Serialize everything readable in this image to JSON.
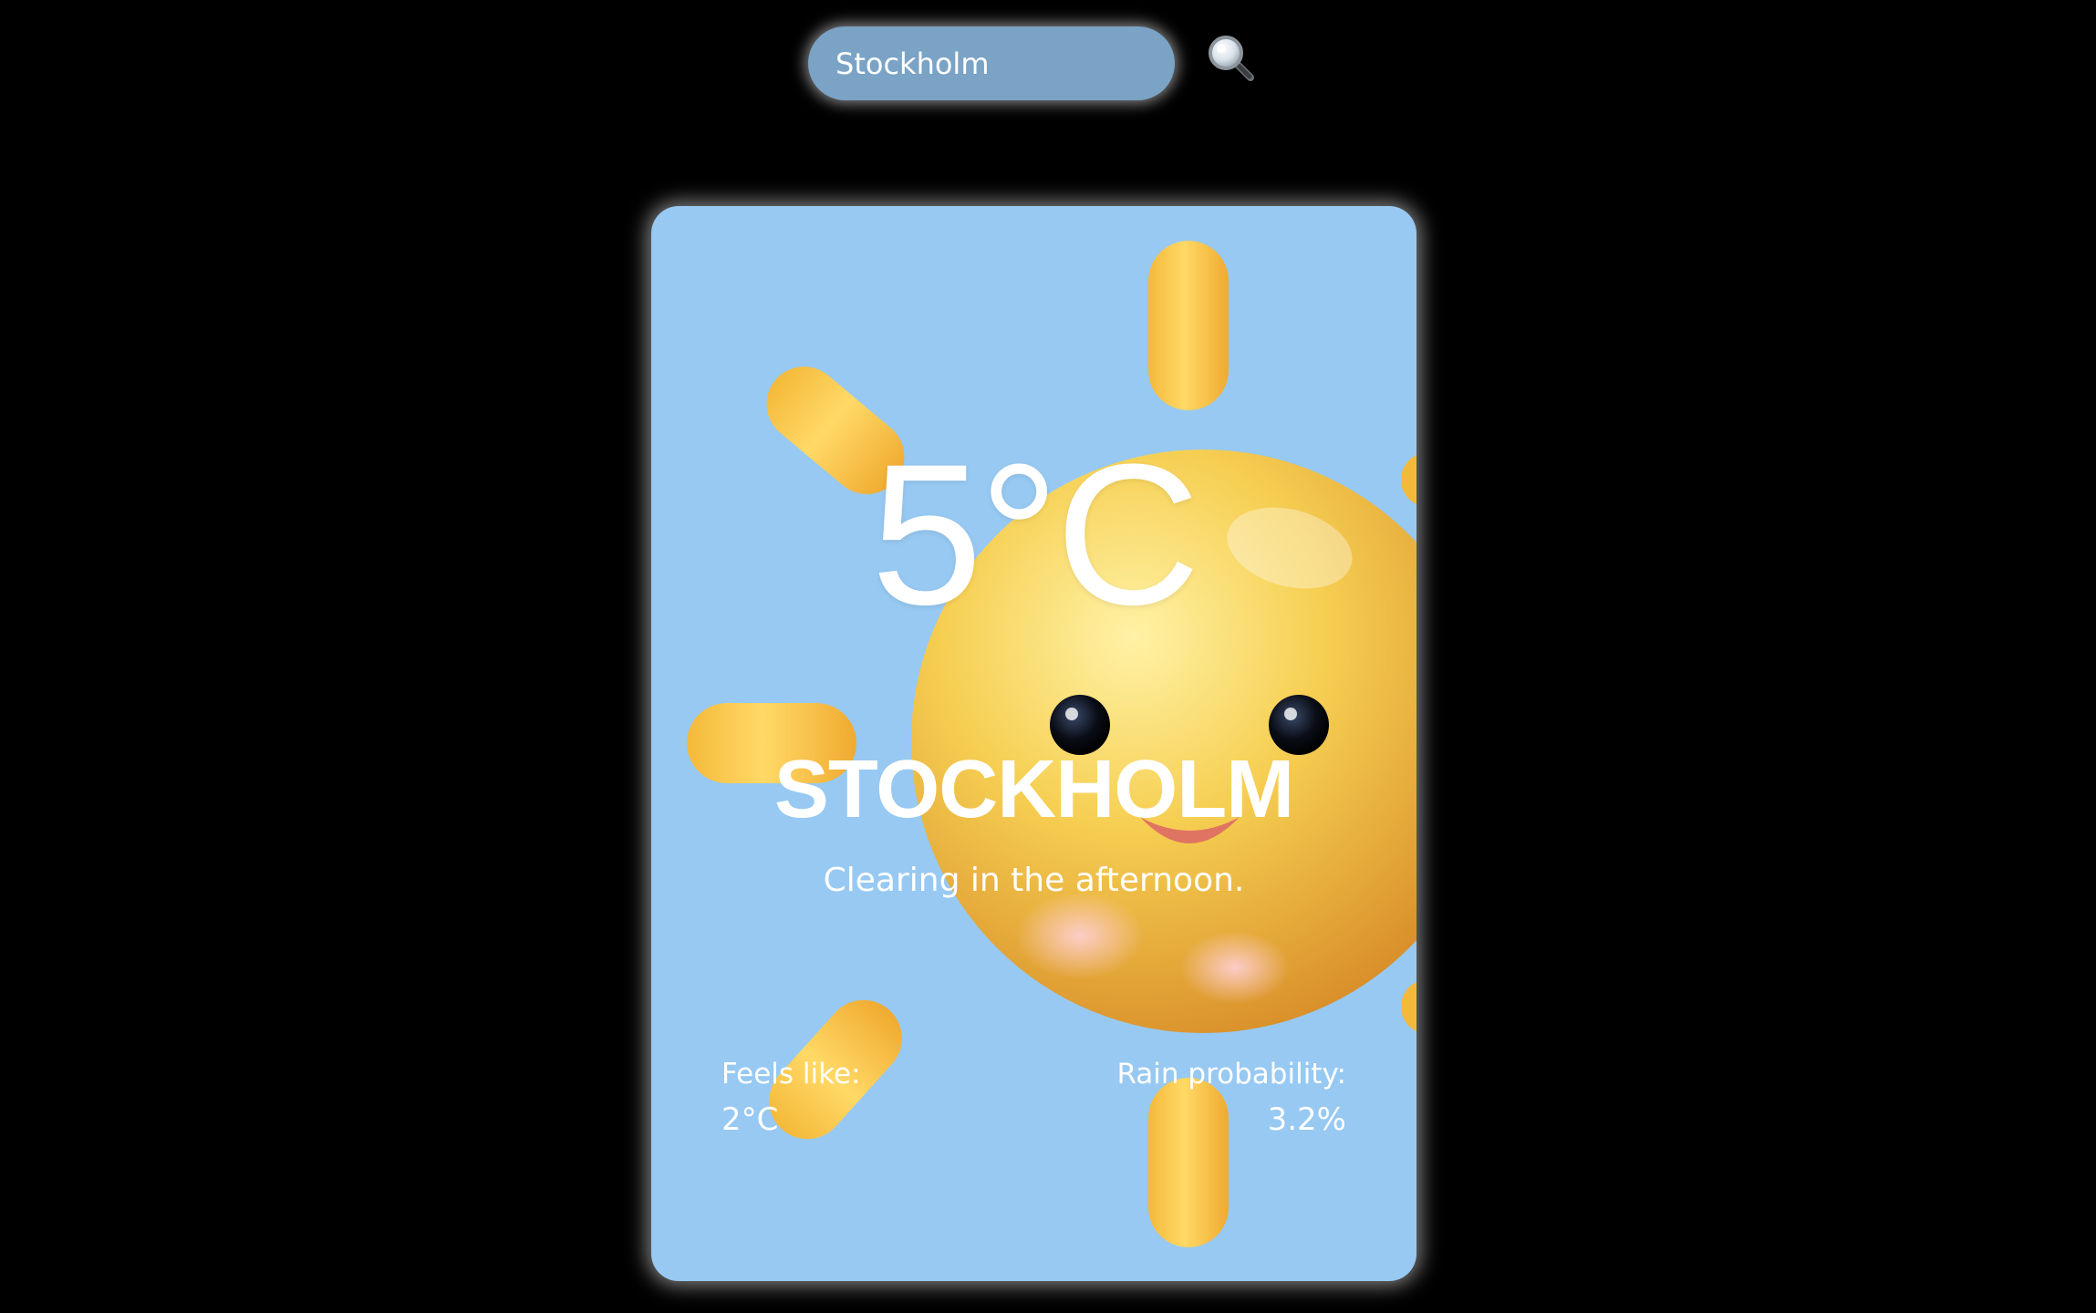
{
  "search": {
    "value": "Stockholm",
    "icon": "magnifying-glass-icon"
  },
  "weather": {
    "temperature": "5°C",
    "city": "STOCKHOLM",
    "description": "Clearing in the afternoon.",
    "feels_like_label": "Feels like:",
    "feels_like_value": "2°C",
    "rain_label": "Rain probability:",
    "rain_value": "3.2%",
    "illustration": "smiling-sun-icon"
  },
  "colors": {
    "page_background": "#000000",
    "search_background": "#7aa3c6",
    "card_background": "#97c9f2",
    "sun": "#f2c94c",
    "text": "#ffffff"
  }
}
